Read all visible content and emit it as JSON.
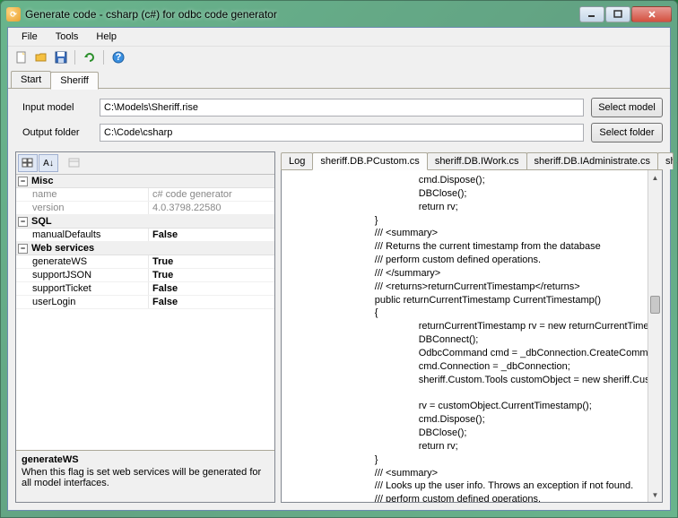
{
  "window": {
    "title": "Generate code - csharp (c#) for odbc code generator"
  },
  "menu": {
    "file": "File",
    "tools": "Tools",
    "help": "Help"
  },
  "maintabs": {
    "start": "Start",
    "sheriff": "Sheriff"
  },
  "form": {
    "inputLabel": "Input model",
    "inputValue": "C:\\Models\\Sheriff.rise",
    "selectModel": "Select model",
    "outputLabel": "Output folder",
    "outputValue": "C:\\Code\\csharp",
    "selectFolder": "Select folder"
  },
  "props": {
    "catMisc": "Misc",
    "nameLabel": "name",
    "nameVal": "c# code generator",
    "versionLabel": "version",
    "versionVal": "4.0.3798.22580",
    "catSQL": "SQL",
    "manualDefaultsLabel": "manualDefaults",
    "manualDefaultsVal": "False",
    "catWeb": "Web services",
    "generateWSLabel": "generateWS",
    "generateWSVal": "True",
    "supportJSONLabel": "supportJSON",
    "supportJSONVal": "True",
    "supportTicketLabel": "supportTicket",
    "supportTicketVal": "False",
    "userLoginLabel": "userLogin",
    "userLoginVal": "False",
    "descTitle": "generateWS",
    "descText": "When this flag is set web services will be generated for all model interfaces."
  },
  "codeTabs": {
    "log": "Log",
    "t1": "sheriff.DB.PCustom.cs",
    "t2": "sheriff.DB.IWork.cs",
    "t3": "sheriff.DB.IAdministrate.cs",
    "t4": "she"
  },
  "code": "                                                cmd.Dispose();\n                                                DBClose();\n                                                return rv;\n                                }\n                                /// <summary>\n                                /// Returns the current timestamp from the database\n                                /// perform custom defined operations.\n                                /// </summary>\n                                /// <returns>returnCurrentTimestamp</returns>\n                                public returnCurrentTimestamp CurrentTimestamp()\n                                {\n                                                returnCurrentTimestamp rv = new returnCurrentTimestamp();\n                                                DBConnect();\n                                                OdbcCommand cmd = _dbConnection.CreateCommand();\n                                                cmd.Connection = _dbConnection;\n                                                sheriff.Custom.Tools customObject = new sheriff.Custom.Tools(cmd);\n\n                                                rv = customObject.CurrentTimestamp();\n                                                cmd.Dispose();\n                                                DBClose();\n                                                return rv;\n                                }\n                                /// <summary>\n                                /// Looks up the user info. Throws an exception if not found.\n                                /// perform custom defined operations."
}
